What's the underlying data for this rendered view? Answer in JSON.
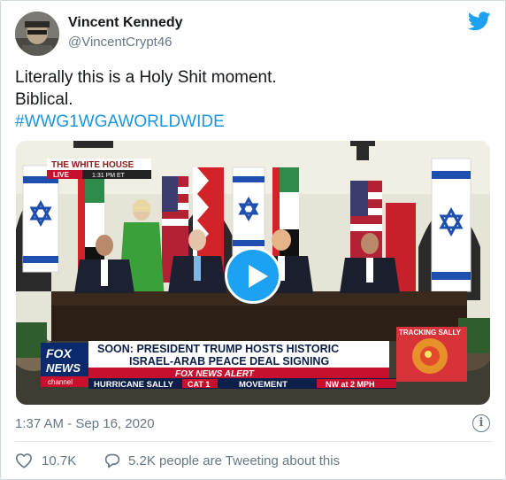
{
  "author": {
    "name": "Vincent Kennedy",
    "handle": "@VincentCrypt46"
  },
  "tweet": {
    "line1": "Literally this is a Holy Shit moment.",
    "line2": "Biblical.",
    "hashtag": "#WWG1WGAWORLDWIDE"
  },
  "video": {
    "network_bug_line1": "THE WHITE HOUSE",
    "live_label": "LIVE",
    "live_time": "1:31 PM ET",
    "headline_line1": "SOON: PRESIDENT TRUMP HOSTS HISTORIC",
    "headline_line2": "ISRAEL-ARAB PEACE DEAL SIGNING",
    "alert_label": "FOX NEWS ALERT",
    "ticker_hurricane": "HURRICANE SALLY",
    "ticker_cat": "CAT 1",
    "ticker_movement": "MOVEMENT",
    "ticker_speed": "NW at 2 MPH",
    "tracking_label": "TRACKING SALLY",
    "logo_line1": "FOX",
    "logo_line2": "NEWS",
    "logo_line3": "channel"
  },
  "meta": {
    "timestamp": "1:37 AM - Sep 16, 2020",
    "info_glyph": "i"
  },
  "engagement": {
    "likes": "10.7K",
    "replies_text": "5.2K people are Tweeting about this"
  },
  "colors": {
    "hashtag": "#1b95e0",
    "twitter_blue": "#1da1f2",
    "secondary_text": "#657786",
    "fox_red": "#c8102e",
    "fox_blue": "#0a2a6b"
  }
}
